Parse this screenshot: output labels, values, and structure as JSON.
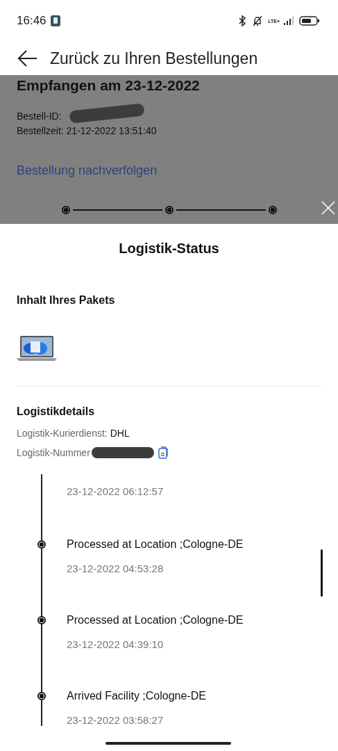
{
  "status_bar": {
    "time": "16:46",
    "network": "LTE+"
  },
  "header": {
    "title": "Zurück zu Ihren Bestellungen"
  },
  "order": {
    "heading": "Empfangen am 23-12-2022",
    "order_id_label": "Bestell-ID:",
    "order_time": "Bestellzeit: 21-12-2022 13:51:40",
    "track_link": "Bestellung nachverfolgen",
    "steps": [
      {
        "done": true
      },
      {
        "done": true
      },
      {
        "done": true
      }
    ]
  },
  "sheet": {
    "title": "Logistik-Status",
    "package_heading": "Inhalt Ihres Pakets",
    "details_heading": "Logistikdetails",
    "courier_label": "Logistik-Kurierdienst:",
    "courier": "DHL",
    "number_label": "Logistik-Nummer",
    "events": [
      {
        "time": "23-12-2022 06:12:57"
      },
      {
        "title": "Processed at Location ;Cologne-DE",
        "time": "23-12-2022 04:53:28"
      },
      {
        "title": "Processed at Location ;Cologne-DE",
        "time": "23-12-2022 04:39:10"
      },
      {
        "title": "Arrived Facility ;Cologne-DE",
        "time": "23-12-2022 03:58:27"
      }
    ]
  }
}
